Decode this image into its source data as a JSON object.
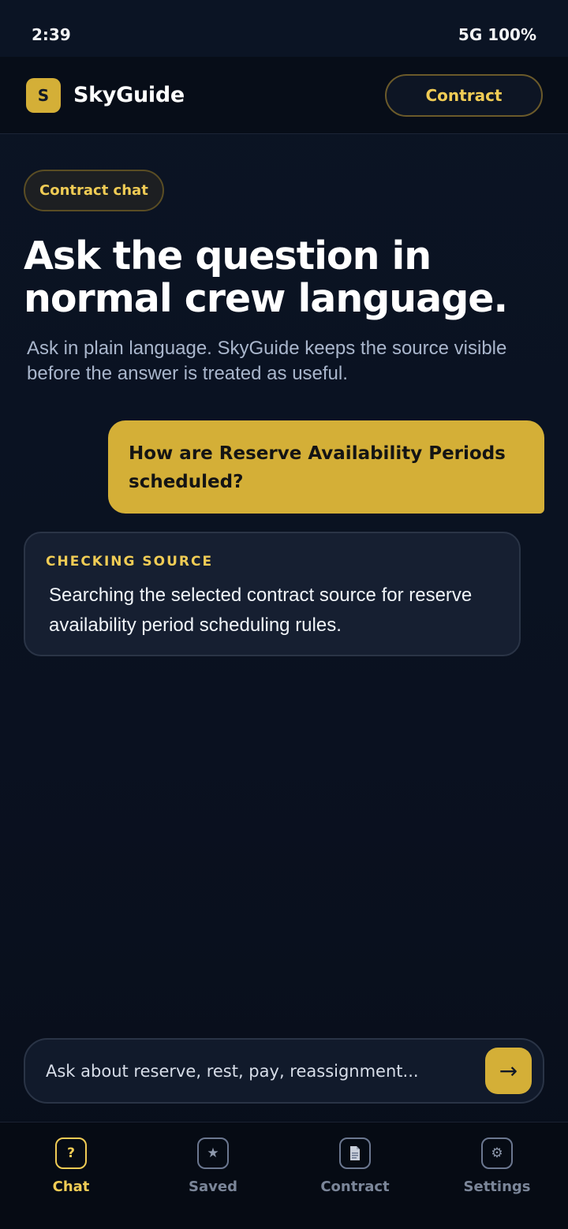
{
  "status_bar": {
    "time": "2:39",
    "network": "5G 100%"
  },
  "header": {
    "logo_letter": "S",
    "app_name": "SkyGuide",
    "contract_button": "Contract"
  },
  "hero": {
    "pill": "Contract chat",
    "title": "Ask the question in normal crew language.",
    "subtitle": "Ask in plain language. SkyGuide keeps the source visible before the answer is treated as useful."
  },
  "messages": {
    "user": "How are Reserve Availability Periods scheduled?",
    "status_label": "CHECKING SOURCE",
    "status_text": "Searching the selected contract source for reserve availability period scheduling rules."
  },
  "composer": {
    "placeholder": "Ask about reserve, rest, pay, reassignment...",
    "send_icon": "→"
  },
  "nav": {
    "items": [
      {
        "label": "Chat",
        "icon": "?"
      },
      {
        "label": "Saved",
        "icon": "★"
      },
      {
        "label": "Contract",
        "icon": "📄"
      },
      {
        "label": "Settings",
        "icon": "⚙"
      }
    ]
  },
  "colors": {
    "accent": "#d4af37",
    "accent_text": "#f0cc55",
    "background": "#0b1424"
  }
}
